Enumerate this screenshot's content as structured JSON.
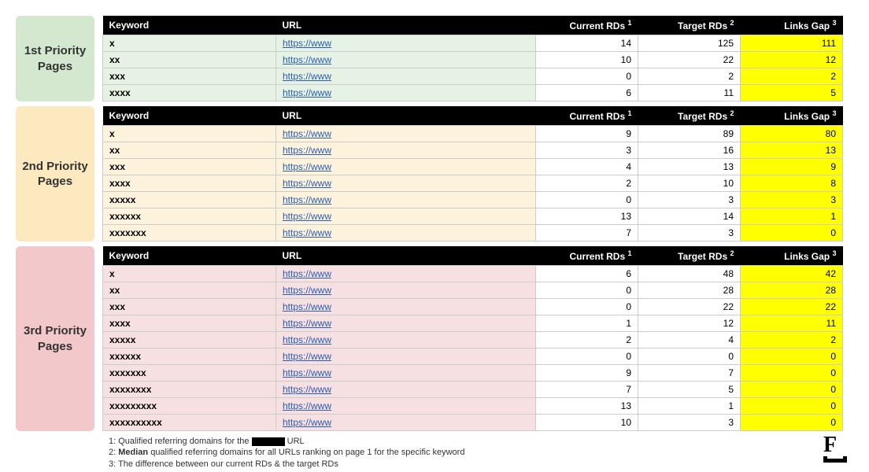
{
  "headers": {
    "keyword": "Keyword",
    "url": "URL",
    "current": "Current RDs",
    "target": "Target RDs",
    "gap": "Links Gap",
    "sup1": "1",
    "sup2": "2",
    "sup3": "3"
  },
  "sections": [
    {
      "badge": "1st Priority Pages",
      "badgeClass": "p1",
      "rows": [
        {
          "kw": "x",
          "url": "https://www",
          "current": 14,
          "target": 125,
          "gap": 111
        },
        {
          "kw": "xx",
          "url": "https://www",
          "current": 10,
          "target": 22,
          "gap": 12
        },
        {
          "kw": "xxx",
          "url": "https://www",
          "current": 0,
          "target": 2,
          "gap": 2
        },
        {
          "kw": "xxxx",
          "url": "https://www",
          "current": 6,
          "target": 11,
          "gap": 5
        }
      ]
    },
    {
      "badge": "2nd Priority Pages",
      "badgeClass": "p2",
      "rows": [
        {
          "kw": "x",
          "url": "https://www",
          "current": 9,
          "target": 89,
          "gap": 80
        },
        {
          "kw": "xx",
          "url": "https://www",
          "current": 3,
          "target": 16,
          "gap": 13
        },
        {
          "kw": "xxx",
          "url": "https://www",
          "current": 4,
          "target": 13,
          "gap": 9
        },
        {
          "kw": "xxxx",
          "url": "https://www",
          "current": 2,
          "target": 10,
          "gap": 8
        },
        {
          "kw": "xxxxx",
          "url": "https://www",
          "current": 0,
          "target": 3,
          "gap": 3
        },
        {
          "kw": "xxxxxx",
          "url": "https://www",
          "current": 13,
          "target": 14,
          "gap": 1
        },
        {
          "kw": "xxxxxxx",
          "url": "https://www",
          "current": 7,
          "target": 3,
          "gap": 0
        }
      ]
    },
    {
      "badge": "3rd Priority Pages",
      "badgeClass": "p3",
      "rows": [
        {
          "kw": "x",
          "url": "https://www",
          "current": 6,
          "target": 48,
          "gap": 42
        },
        {
          "kw": "xx",
          "url": "https://www",
          "current": 0,
          "target": 28,
          "gap": 28
        },
        {
          "kw": "xxx",
          "url": "https://www",
          "current": 0,
          "target": 22,
          "gap": 22
        },
        {
          "kw": "xxxx",
          "url": "https://www",
          "current": 1,
          "target": 12,
          "gap": 11
        },
        {
          "kw": "xxxxx",
          "url": "https://www",
          "current": 2,
          "target": 4,
          "gap": 2
        },
        {
          "kw": "xxxxxx",
          "url": "https://www",
          "current": 0,
          "target": 0,
          "gap": 0
        },
        {
          "kw": "xxxxxxx",
          "url": "https://www",
          "current": 9,
          "target": 7,
          "gap": 0
        },
        {
          "kw": "xxxxxxxx",
          "url": "https://www",
          "current": 7,
          "target": 5,
          "gap": 0
        },
        {
          "kw": "xxxxxxxxx",
          "url": "https://www",
          "current": 13,
          "target": 1,
          "gap": 0
        },
        {
          "kw": "xxxxxxxxxx",
          "url": "https://www",
          "current": 10,
          "target": 3,
          "gap": 0
        }
      ]
    }
  ],
  "footnotes": {
    "f1a": "1: Qualified referring domains for the",
    "f1b": "URL",
    "f2": "2: Median qualified referring domains for all URLs ranking on page 1 for the specific keyword",
    "f2_bold": "Median",
    "f2_pre": "2: ",
    "f2_post": " qualified referring domains for all URLs ranking on page 1 for the specific keyword",
    "f3": "3: The difference between our current RDs & the target RDs"
  },
  "logo": "F"
}
